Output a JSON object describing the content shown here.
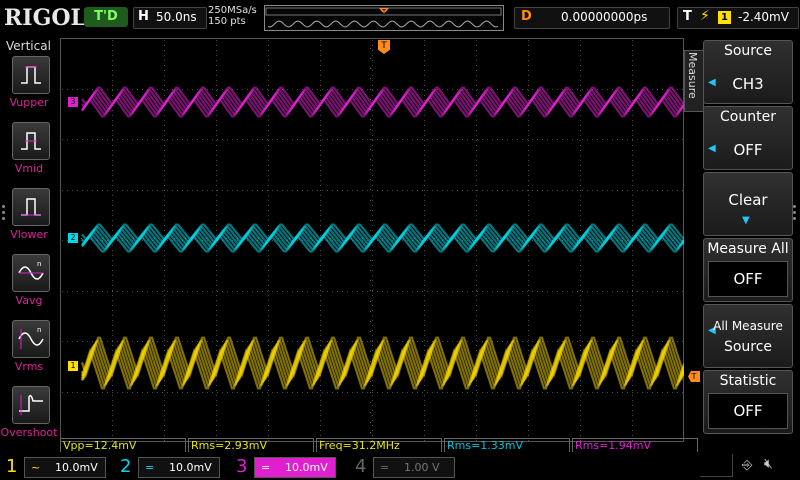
{
  "brand": "RIGOL",
  "top": {
    "trigger_status": "T'D",
    "horizontal_letter": "H",
    "timebase": "50.0ns",
    "sample_rate": "250MSa/s",
    "points": "150 pts",
    "delay_letter": "D",
    "delay": "0.00000000ps",
    "trigger_letter": "T",
    "trigger_edge_icon": "rising-edge-icon",
    "trigger_source": "1",
    "trigger_level": "-2.40mV"
  },
  "left_panel": {
    "title": "Vertical",
    "items": [
      {
        "label": "Vupper",
        "icon": "vupper-icon"
      },
      {
        "label": "Vmid",
        "icon": "vmid-icon"
      },
      {
        "label": "Vlower",
        "icon": "vlower-icon"
      },
      {
        "label": "Vavg",
        "icon": "vavg-icon"
      },
      {
        "label": "Vrms",
        "icon": "vrms-icon"
      },
      {
        "label": "Overshoot",
        "icon": "overshoot-icon"
      }
    ]
  },
  "screen": {
    "ch3_marker": "3",
    "ch2_marker": "2",
    "ch1_marker": "1",
    "trigger_top_marker": "T",
    "trigger_right_marker": "T"
  },
  "right_panel": {
    "tab_label": "Measure",
    "source_title": "Source",
    "source_value": "CH3",
    "counter_title": "Counter",
    "counter_value": "OFF",
    "clear_title": "Clear",
    "measure_all_title": "Measure All",
    "measure_all_value": "OFF",
    "all_measure_source_line1": "All Measure",
    "all_measure_source_line2": "Source",
    "statistic_title": "Statistic",
    "statistic_value": "OFF"
  },
  "measurements": [
    {
      "text": "Vpp=12.4mV",
      "color": "#e8e800"
    },
    {
      "text": "Rms=2.93mV",
      "color": "#e8e800"
    },
    {
      "text": "Freq=31.2MHz",
      "color": "#e8e800"
    },
    {
      "text": "Rms=1.33mV",
      "color": "#00c8d8"
    },
    {
      "text": "Rms=1.94mV",
      "color": "#e020d0"
    }
  ],
  "channels": [
    {
      "num": "1",
      "coupling": "~",
      "scale": "10.0mV",
      "color": "#ffe000"
    },
    {
      "num": "2",
      "coupling": "=",
      "scale": "10.0mV",
      "color": "#00d8e8"
    },
    {
      "num": "3",
      "coupling": "=",
      "scale": "10.0mV",
      "color": "#e020d0"
    },
    {
      "num": "4",
      "coupling": "=",
      "scale": "1.00 V",
      "color": "#666666"
    }
  ],
  "status_icons": [
    "usb-icon",
    "mute-speaker-icon"
  ],
  "colors": {
    "ch1": "#ffe000",
    "ch2": "#00d8e8",
    "ch3": "#e020d0",
    "trigger": "#ff8c1a",
    "grid": "#3a3a3a"
  }
}
